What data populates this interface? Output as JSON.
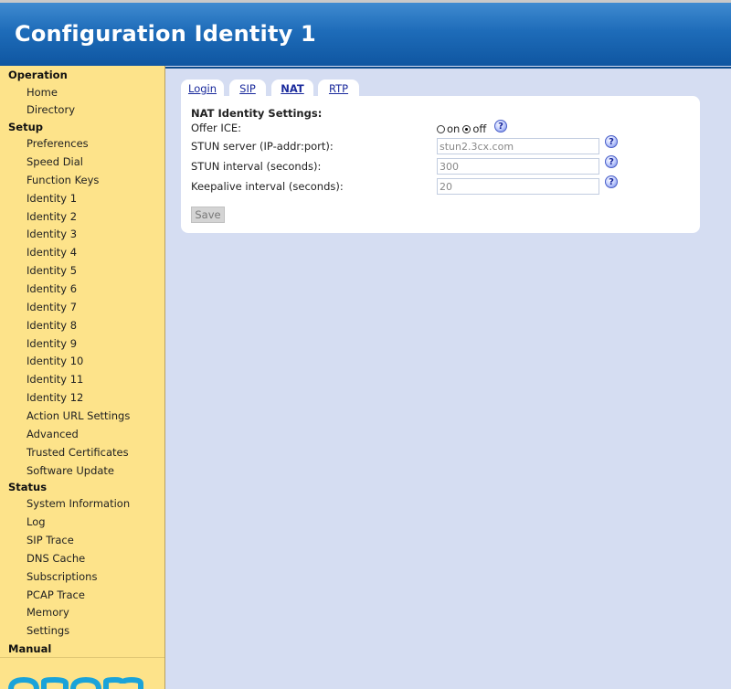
{
  "header": {
    "title": "Configuration Identity 1"
  },
  "sidebar": {
    "operation": {
      "label": "Operation",
      "items": [
        "Home",
        "Directory"
      ]
    },
    "setup": {
      "label": "Setup",
      "items": [
        "Preferences",
        "Speed Dial",
        "Function Keys",
        "Identity 1",
        "Identity 2",
        "Identity 3",
        "Identity 4",
        "Identity 5",
        "Identity 6",
        "Identity 7",
        "Identity 8",
        "Identity 9",
        "Identity 10",
        "Identity 11",
        "Identity 12",
        "Action URL Settings",
        "Advanced",
        "Trusted Certificates",
        "Software Update"
      ]
    },
    "status": {
      "label": "Status",
      "items": [
        "System Information",
        "Log",
        "SIP Trace",
        "DNS Cache",
        "Subscriptions",
        "PCAP Trace",
        "Memory",
        "Settings"
      ]
    },
    "manual": {
      "label": "Manual"
    }
  },
  "tabs": [
    {
      "label": "Login",
      "active": false
    },
    {
      "label": "SIP",
      "active": false
    },
    {
      "label": "NAT",
      "active": true
    },
    {
      "label": "RTP",
      "active": false
    }
  ],
  "nat": {
    "title": "NAT Identity Settings:",
    "offer_ice": {
      "label": "Offer ICE:",
      "on_label": "on",
      "off_label": "off",
      "selected": "off"
    },
    "stun_server": {
      "label": "STUN server (IP-addr:port):",
      "value": "stun2.3cx.com"
    },
    "stun_interval": {
      "label": "STUN interval (seconds):",
      "value": "300"
    },
    "keepalive_interval": {
      "label": "Keepalive interval (seconds):",
      "value": "20"
    },
    "help_glyph": "?",
    "save_label": "Save"
  },
  "colors": {
    "header": "#1e6cb9",
    "sidebar": "#fde38a",
    "content_bg": "#d5ddf2",
    "link": "#1a2a9c",
    "logo": "#1aa3d9"
  },
  "logo": {
    "icon": "snom-logo-icon"
  }
}
